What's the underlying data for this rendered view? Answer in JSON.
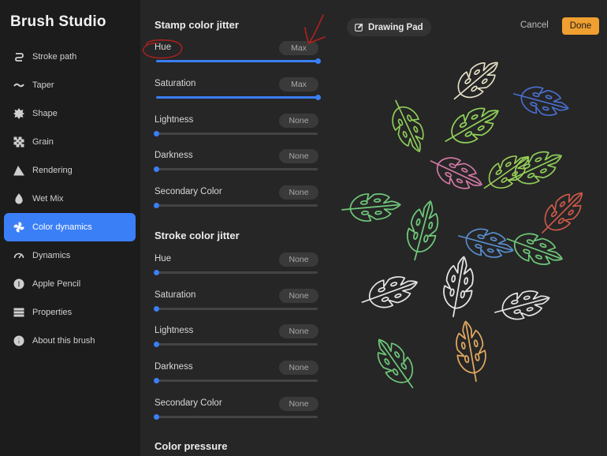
{
  "sidebar": {
    "title": "Brush Studio",
    "items": [
      {
        "label": "Stroke path",
        "icon": "stroke-path-icon"
      },
      {
        "label": "Taper",
        "icon": "taper-icon"
      },
      {
        "label": "Shape",
        "icon": "shape-icon"
      },
      {
        "label": "Grain",
        "icon": "grain-icon"
      },
      {
        "label": "Rendering",
        "icon": "rendering-icon"
      },
      {
        "label": "Wet Mix",
        "icon": "wet-mix-icon"
      },
      {
        "label": "Color dynamics",
        "icon": "color-dynamics-icon",
        "active": true
      },
      {
        "label": "Dynamics",
        "icon": "dynamics-icon"
      },
      {
        "label": "Apple Pencil",
        "icon": "apple-pencil-icon"
      },
      {
        "label": "Properties",
        "icon": "properties-icon"
      },
      {
        "label": "About this brush",
        "icon": "about-icon"
      }
    ]
  },
  "stamp": {
    "title": "Stamp color jitter",
    "rows": [
      {
        "label": "Hue",
        "value": "Max",
        "fraction": 1.0
      },
      {
        "label": "Saturation",
        "value": "Max",
        "fraction": 1.0
      },
      {
        "label": "Lightness",
        "value": "None",
        "fraction": 0.0
      },
      {
        "label": "Darkness",
        "value": "None",
        "fraction": 0.0
      },
      {
        "label": "Secondary Color",
        "value": "None",
        "fraction": 0.0
      }
    ]
  },
  "stroke": {
    "title": "Stroke color jitter",
    "rows": [
      {
        "label": "Hue",
        "value": "None",
        "fraction": 0.0
      },
      {
        "label": "Saturation",
        "value": "None",
        "fraction": 0.0
      },
      {
        "label": "Lightness",
        "value": "None",
        "fraction": 0.0
      },
      {
        "label": "Darkness",
        "value": "None",
        "fraction": 0.0
      },
      {
        "label": "Secondary Color",
        "value": "None",
        "fraction": 0.0
      }
    ]
  },
  "pressure": {
    "title": "Color pressure"
  },
  "pad": {
    "label": "Drawing Pad",
    "cancel": "Cancel",
    "done": "Done"
  },
  "colors": {
    "accent": "#3a7ff6",
    "done": "#f0a030",
    "annotation": "#b02020"
  }
}
